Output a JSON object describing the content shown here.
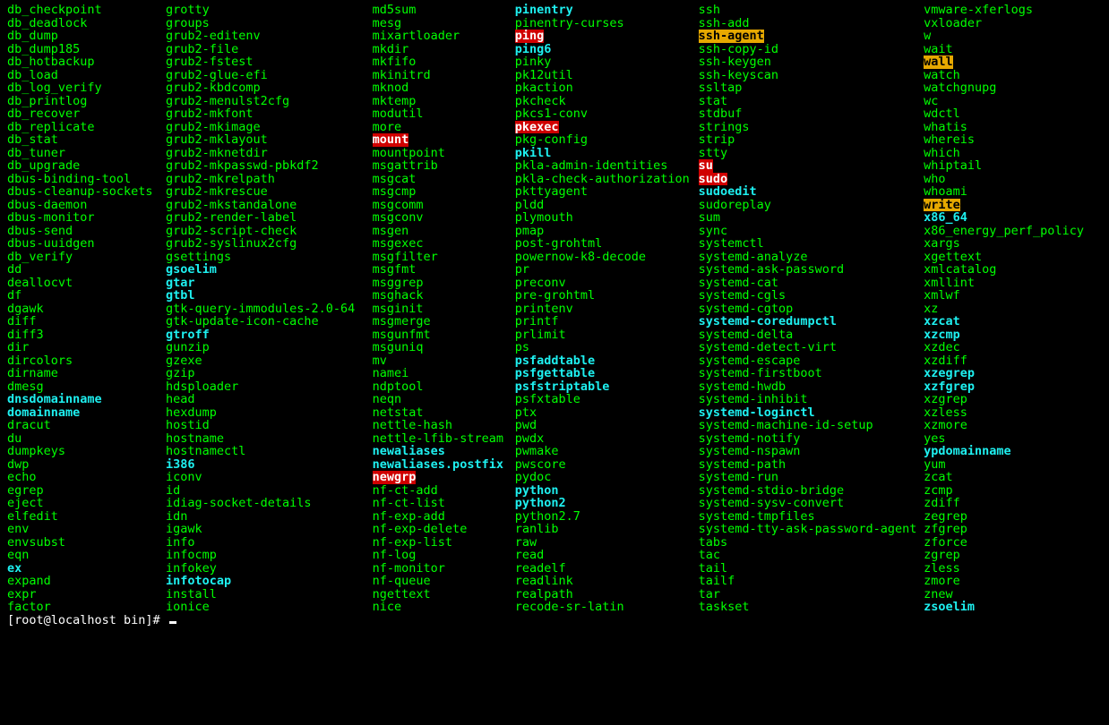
{
  "prompt": "[root@localhost bin]# ",
  "columns": [
    [
      {
        "t": "db_checkpoint",
        "c": "plain"
      },
      {
        "t": "db_deadlock",
        "c": "plain"
      },
      {
        "t": "db_dump",
        "c": "plain"
      },
      {
        "t": "db_dump185",
        "c": "plain"
      },
      {
        "t": "db_hotbackup",
        "c": "plain"
      },
      {
        "t": "db_load",
        "c": "plain"
      },
      {
        "t": "db_log_verify",
        "c": "plain"
      },
      {
        "t": "db_printlog",
        "c": "plain"
      },
      {
        "t": "db_recover",
        "c": "plain"
      },
      {
        "t": "db_replicate",
        "c": "plain"
      },
      {
        "t": "db_stat",
        "c": "plain"
      },
      {
        "t": "db_tuner",
        "c": "plain"
      },
      {
        "t": "db_upgrade",
        "c": "plain"
      },
      {
        "t": "dbus-binding-tool",
        "c": "plain"
      },
      {
        "t": "dbus-cleanup-sockets",
        "c": "plain"
      },
      {
        "t": "dbus-daemon",
        "c": "plain"
      },
      {
        "t": "dbus-monitor",
        "c": "plain"
      },
      {
        "t": "dbus-send",
        "c": "plain"
      },
      {
        "t": "dbus-uuidgen",
        "c": "plain"
      },
      {
        "t": "db_verify",
        "c": "plain"
      },
      {
        "t": "dd",
        "c": "plain"
      },
      {
        "t": "deallocvt",
        "c": "plain"
      },
      {
        "t": "df",
        "c": "plain"
      },
      {
        "t": "dgawk",
        "c": "plain"
      },
      {
        "t": "diff",
        "c": "plain"
      },
      {
        "t": "diff3",
        "c": "plain"
      },
      {
        "t": "dir",
        "c": "plain"
      },
      {
        "t": "dircolors",
        "c": "plain"
      },
      {
        "t": "dirname",
        "c": "plain"
      },
      {
        "t": "dmesg",
        "c": "plain"
      },
      {
        "t": "dnsdomainname",
        "c": "bold"
      },
      {
        "t": "domainname",
        "c": "bold"
      },
      {
        "t": "dracut",
        "c": "plain"
      },
      {
        "t": "du",
        "c": "plain"
      },
      {
        "t": "dumpkeys",
        "c": "plain"
      },
      {
        "t": "dwp",
        "c": "plain"
      },
      {
        "t": "echo",
        "c": "plain"
      },
      {
        "t": "egrep",
        "c": "plain"
      },
      {
        "t": "eject",
        "c": "plain"
      },
      {
        "t": "elfedit",
        "c": "plain"
      },
      {
        "t": "env",
        "c": "plain"
      },
      {
        "t": "envsubst",
        "c": "plain"
      },
      {
        "t": "eqn",
        "c": "plain"
      },
      {
        "t": "ex",
        "c": "bold"
      },
      {
        "t": "expand",
        "c": "plain"
      },
      {
        "t": "expr",
        "c": "plain"
      },
      {
        "t": "factor",
        "c": "plain"
      }
    ],
    [
      {
        "t": "grotty",
        "c": "plain"
      },
      {
        "t": "groups",
        "c": "plain"
      },
      {
        "t": "grub2-editenv",
        "c": "plain"
      },
      {
        "t": "grub2-file",
        "c": "plain"
      },
      {
        "t": "grub2-fstest",
        "c": "plain"
      },
      {
        "t": "grub2-glue-efi",
        "c": "plain"
      },
      {
        "t": "grub2-kbdcomp",
        "c": "plain"
      },
      {
        "t": "grub2-menulst2cfg",
        "c": "plain"
      },
      {
        "t": "grub2-mkfont",
        "c": "plain"
      },
      {
        "t": "grub2-mkimage",
        "c": "plain"
      },
      {
        "t": "grub2-mklayout",
        "c": "plain"
      },
      {
        "t": "grub2-mknetdir",
        "c": "plain"
      },
      {
        "t": "grub2-mkpasswd-pbkdf2",
        "c": "plain"
      },
      {
        "t": "grub2-mkrelpath",
        "c": "plain"
      },
      {
        "t": "grub2-mkrescue",
        "c": "plain"
      },
      {
        "t": "grub2-mkstandalone",
        "c": "plain"
      },
      {
        "t": "grub2-render-label",
        "c": "plain"
      },
      {
        "t": "grub2-script-check",
        "c": "plain"
      },
      {
        "t": "grub2-syslinux2cfg",
        "c": "plain"
      },
      {
        "t": "gsettings",
        "c": "plain"
      },
      {
        "t": "gsoelim",
        "c": "bold"
      },
      {
        "t": "gtar",
        "c": "bold"
      },
      {
        "t": "gtbl",
        "c": "bold"
      },
      {
        "t": "gtk-query-immodules-2.0-64",
        "c": "plain"
      },
      {
        "t": "gtk-update-icon-cache",
        "c": "plain"
      },
      {
        "t": "gtroff",
        "c": "bold"
      },
      {
        "t": "gunzip",
        "c": "plain"
      },
      {
        "t": "gzexe",
        "c": "plain"
      },
      {
        "t": "gzip",
        "c": "plain"
      },
      {
        "t": "hdsploader",
        "c": "plain"
      },
      {
        "t": "head",
        "c": "plain"
      },
      {
        "t": "hexdump",
        "c": "plain"
      },
      {
        "t": "hostid",
        "c": "plain"
      },
      {
        "t": "hostname",
        "c": "plain"
      },
      {
        "t": "hostnamectl",
        "c": "plain"
      },
      {
        "t": "i386",
        "c": "bold"
      },
      {
        "t": "iconv",
        "c": "plain"
      },
      {
        "t": "id",
        "c": "plain"
      },
      {
        "t": "idiag-socket-details",
        "c": "plain"
      },
      {
        "t": "idn",
        "c": "plain"
      },
      {
        "t": "igawk",
        "c": "plain"
      },
      {
        "t": "info",
        "c": "plain"
      },
      {
        "t": "infocmp",
        "c": "plain"
      },
      {
        "t": "infokey",
        "c": "plain"
      },
      {
        "t": "infotocap",
        "c": "bold"
      },
      {
        "t": "install",
        "c": "plain"
      },
      {
        "t": "ionice",
        "c": "plain"
      }
    ],
    [
      {
        "t": "md5sum",
        "c": "plain"
      },
      {
        "t": "mesg",
        "c": "plain"
      },
      {
        "t": "mixartloader",
        "c": "plain"
      },
      {
        "t": "mkdir",
        "c": "plain"
      },
      {
        "t": "mkfifo",
        "c": "plain"
      },
      {
        "t": "mkinitrd",
        "c": "plain"
      },
      {
        "t": "mknod",
        "c": "plain"
      },
      {
        "t": "mktemp",
        "c": "plain"
      },
      {
        "t": "modutil",
        "c": "plain"
      },
      {
        "t": "more",
        "c": "plain"
      },
      {
        "t": "mount",
        "c": "suid"
      },
      {
        "t": "mountpoint",
        "c": "plain"
      },
      {
        "t": "msgattrib",
        "c": "plain"
      },
      {
        "t": "msgcat",
        "c": "plain"
      },
      {
        "t": "msgcmp",
        "c": "plain"
      },
      {
        "t": "msgcomm",
        "c": "plain"
      },
      {
        "t": "msgconv",
        "c": "plain"
      },
      {
        "t": "msgen",
        "c": "plain"
      },
      {
        "t": "msgexec",
        "c": "plain"
      },
      {
        "t": "msgfilter",
        "c": "plain"
      },
      {
        "t": "msgfmt",
        "c": "plain"
      },
      {
        "t": "msggrep",
        "c": "plain"
      },
      {
        "t": "msghack",
        "c": "plain"
      },
      {
        "t": "msginit",
        "c": "plain"
      },
      {
        "t": "msgmerge",
        "c": "plain"
      },
      {
        "t": "msgunfmt",
        "c": "plain"
      },
      {
        "t": "msguniq",
        "c": "plain"
      },
      {
        "t": "mv",
        "c": "plain"
      },
      {
        "t": "namei",
        "c": "plain"
      },
      {
        "t": "ndptool",
        "c": "plain"
      },
      {
        "t": "neqn",
        "c": "plain"
      },
      {
        "t": "netstat",
        "c": "plain"
      },
      {
        "t": "nettle-hash",
        "c": "plain"
      },
      {
        "t": "nettle-lfib-stream",
        "c": "plain"
      },
      {
        "t": "newaliases",
        "c": "bold"
      },
      {
        "t": "newaliases.postfix",
        "c": "bold"
      },
      {
        "t": "newgrp",
        "c": "suid"
      },
      {
        "t": "nf-ct-add",
        "c": "plain"
      },
      {
        "t": "nf-ct-list",
        "c": "plain"
      },
      {
        "t": "nf-exp-add",
        "c": "plain"
      },
      {
        "t": "nf-exp-delete",
        "c": "plain"
      },
      {
        "t": "nf-exp-list",
        "c": "plain"
      },
      {
        "t": "nf-log",
        "c": "plain"
      },
      {
        "t": "nf-monitor",
        "c": "plain"
      },
      {
        "t": "nf-queue",
        "c": "plain"
      },
      {
        "t": "ngettext",
        "c": "plain"
      },
      {
        "t": "nice",
        "c": "plain"
      }
    ],
    [
      {
        "t": "pinentry",
        "c": "bold"
      },
      {
        "t": "pinentry-curses",
        "c": "plain"
      },
      {
        "t": "ping",
        "c": "suid"
      },
      {
        "t": "ping6",
        "c": "bold"
      },
      {
        "t": "pinky",
        "c": "plain"
      },
      {
        "t": "pk12util",
        "c": "plain"
      },
      {
        "t": "pkaction",
        "c": "plain"
      },
      {
        "t": "pkcheck",
        "c": "plain"
      },
      {
        "t": "pkcs1-conv",
        "c": "plain"
      },
      {
        "t": "pkexec",
        "c": "suid"
      },
      {
        "t": "pkg-config",
        "c": "plain"
      },
      {
        "t": "pkill",
        "c": "bold"
      },
      {
        "t": "pkla-admin-identities",
        "c": "plain"
      },
      {
        "t": "pkla-check-authorization",
        "c": "plain"
      },
      {
        "t": "pkttyagent",
        "c": "plain"
      },
      {
        "t": "pldd",
        "c": "plain"
      },
      {
        "t": "plymouth",
        "c": "plain"
      },
      {
        "t": "pmap",
        "c": "plain"
      },
      {
        "t": "post-grohtml",
        "c": "plain"
      },
      {
        "t": "powernow-k8-decode",
        "c": "plain"
      },
      {
        "t": "pr",
        "c": "plain"
      },
      {
        "t": "preconv",
        "c": "plain"
      },
      {
        "t": "pre-grohtml",
        "c": "plain"
      },
      {
        "t": "printenv",
        "c": "plain"
      },
      {
        "t": "printf",
        "c": "plain"
      },
      {
        "t": "prlimit",
        "c": "plain"
      },
      {
        "t": "ps",
        "c": "plain"
      },
      {
        "t": "psfaddtable",
        "c": "bold"
      },
      {
        "t": "psfgettable",
        "c": "bold"
      },
      {
        "t": "psfstriptable",
        "c": "bold"
      },
      {
        "t": "psfxtable",
        "c": "plain"
      },
      {
        "t": "ptx",
        "c": "plain"
      },
      {
        "t": "pwd",
        "c": "plain"
      },
      {
        "t": "pwdx",
        "c": "plain"
      },
      {
        "t": "pwmake",
        "c": "plain"
      },
      {
        "t": "pwscore",
        "c": "plain"
      },
      {
        "t": "pydoc",
        "c": "plain"
      },
      {
        "t": "python",
        "c": "bold"
      },
      {
        "t": "python2",
        "c": "bold"
      },
      {
        "t": "python2.7",
        "c": "plain"
      },
      {
        "t": "ranlib",
        "c": "plain"
      },
      {
        "t": "raw",
        "c": "plain"
      },
      {
        "t": "read",
        "c": "plain"
      },
      {
        "t": "readelf",
        "c": "plain"
      },
      {
        "t": "readlink",
        "c": "plain"
      },
      {
        "t": "realpath",
        "c": "plain"
      },
      {
        "t": "recode-sr-latin",
        "c": "plain"
      }
    ],
    [
      {
        "t": "ssh",
        "c": "plain"
      },
      {
        "t": "ssh-add",
        "c": "plain"
      },
      {
        "t": "ssh-agent",
        "c": "sgid"
      },
      {
        "t": "ssh-copy-id",
        "c": "plain"
      },
      {
        "t": "ssh-keygen",
        "c": "plain"
      },
      {
        "t": "ssh-keyscan",
        "c": "plain"
      },
      {
        "t": "ssltap",
        "c": "plain"
      },
      {
        "t": "stat",
        "c": "plain"
      },
      {
        "t": "stdbuf",
        "c": "plain"
      },
      {
        "t": "strings",
        "c": "plain"
      },
      {
        "t": "strip",
        "c": "plain"
      },
      {
        "t": "stty",
        "c": "plain"
      },
      {
        "t": "su",
        "c": "suid"
      },
      {
        "t": "sudo",
        "c": "suid"
      },
      {
        "t": "sudoedit",
        "c": "bold"
      },
      {
        "t": "sudoreplay",
        "c": "plain"
      },
      {
        "t": "sum",
        "c": "plain"
      },
      {
        "t": "sync",
        "c": "plain"
      },
      {
        "t": "systemctl",
        "c": "plain"
      },
      {
        "t": "systemd-analyze",
        "c": "plain"
      },
      {
        "t": "systemd-ask-password",
        "c": "plain"
      },
      {
        "t": "systemd-cat",
        "c": "plain"
      },
      {
        "t": "systemd-cgls",
        "c": "plain"
      },
      {
        "t": "systemd-cgtop",
        "c": "plain"
      },
      {
        "t": "systemd-coredumpctl",
        "c": "bold"
      },
      {
        "t": "systemd-delta",
        "c": "plain"
      },
      {
        "t": "systemd-detect-virt",
        "c": "plain"
      },
      {
        "t": "systemd-escape",
        "c": "plain"
      },
      {
        "t": "systemd-firstboot",
        "c": "plain"
      },
      {
        "t": "systemd-hwdb",
        "c": "plain"
      },
      {
        "t": "systemd-inhibit",
        "c": "plain"
      },
      {
        "t": "systemd-loginctl",
        "c": "bold"
      },
      {
        "t": "systemd-machine-id-setup",
        "c": "plain"
      },
      {
        "t": "systemd-notify",
        "c": "plain"
      },
      {
        "t": "systemd-nspawn",
        "c": "plain"
      },
      {
        "t": "systemd-path",
        "c": "plain"
      },
      {
        "t": "systemd-run",
        "c": "plain"
      },
      {
        "t": "systemd-stdio-bridge",
        "c": "plain"
      },
      {
        "t": "systemd-sysv-convert",
        "c": "plain"
      },
      {
        "t": "systemd-tmpfiles",
        "c": "plain"
      },
      {
        "t": "systemd-tty-ask-password-agent",
        "c": "plain"
      },
      {
        "t": "tabs",
        "c": "plain"
      },
      {
        "t": "tac",
        "c": "plain"
      },
      {
        "t": "tail",
        "c": "plain"
      },
      {
        "t": "tailf",
        "c": "plain"
      },
      {
        "t": "tar",
        "c": "plain"
      },
      {
        "t": "taskset",
        "c": "plain"
      }
    ],
    [
      {
        "t": "vmware-xferlogs",
        "c": "plain"
      },
      {
        "t": "vxloader",
        "c": "plain"
      },
      {
        "t": "w",
        "c": "plain"
      },
      {
        "t": "wait",
        "c": "plain"
      },
      {
        "t": "wall",
        "c": "sgid"
      },
      {
        "t": "watch",
        "c": "plain"
      },
      {
        "t": "watchgnupg",
        "c": "plain"
      },
      {
        "t": "wc",
        "c": "plain"
      },
      {
        "t": "wdctl",
        "c": "plain"
      },
      {
        "t": "whatis",
        "c": "plain"
      },
      {
        "t": "whereis",
        "c": "plain"
      },
      {
        "t": "which",
        "c": "plain"
      },
      {
        "t": "whiptail",
        "c": "plain"
      },
      {
        "t": "who",
        "c": "plain"
      },
      {
        "t": "whoami",
        "c": "plain"
      },
      {
        "t": "write",
        "c": "sgid"
      },
      {
        "t": "x86_64",
        "c": "bold"
      },
      {
        "t": "x86_energy_perf_policy",
        "c": "plain"
      },
      {
        "t": "xargs",
        "c": "plain"
      },
      {
        "t": "xgettext",
        "c": "plain"
      },
      {
        "t": "xmlcatalog",
        "c": "plain"
      },
      {
        "t": "xmllint",
        "c": "plain"
      },
      {
        "t": "xmlwf",
        "c": "plain"
      },
      {
        "t": "xz",
        "c": "plain"
      },
      {
        "t": "xzcat",
        "c": "bold"
      },
      {
        "t": "xzcmp",
        "c": "bold"
      },
      {
        "t": "xzdec",
        "c": "plain"
      },
      {
        "t": "xzdiff",
        "c": "plain"
      },
      {
        "t": "xzegrep",
        "c": "bold"
      },
      {
        "t": "xzfgrep",
        "c": "bold"
      },
      {
        "t": "xzgrep",
        "c": "plain"
      },
      {
        "t": "xzless",
        "c": "plain"
      },
      {
        "t": "xzmore",
        "c": "plain"
      },
      {
        "t": "yes",
        "c": "plain"
      },
      {
        "t": "ypdomainname",
        "c": "bold"
      },
      {
        "t": "yum",
        "c": "plain"
      },
      {
        "t": "zcat",
        "c": "plain"
      },
      {
        "t": "zcmp",
        "c": "plain"
      },
      {
        "t": "zdiff",
        "c": "plain"
      },
      {
        "t": "zegrep",
        "c": "plain"
      },
      {
        "t": "zfgrep",
        "c": "plain"
      },
      {
        "t": "zforce",
        "c": "plain"
      },
      {
        "t": "zgrep",
        "c": "plain"
      },
      {
        "t": "zless",
        "c": "plain"
      },
      {
        "t": "zmore",
        "c": "plain"
      },
      {
        "t": "znew",
        "c": "plain"
      },
      {
        "t": "zsoelim",
        "c": "bold"
      }
    ]
  ]
}
